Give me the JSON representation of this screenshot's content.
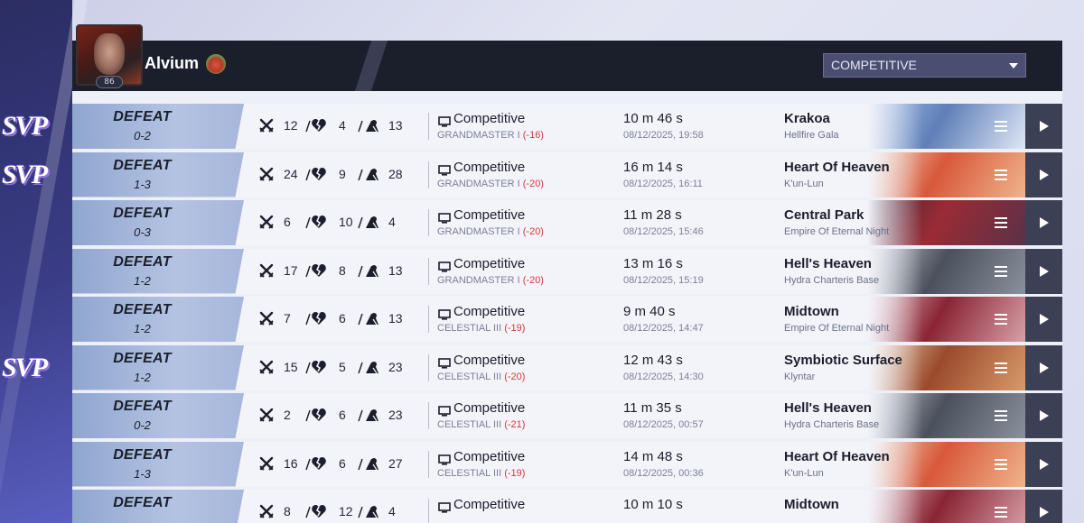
{
  "player": {
    "name": "Alvium",
    "level": "86"
  },
  "mode_select": {
    "value": "COMPETITIVE"
  },
  "svp_label": "SVP",
  "matches": [
    {
      "result": "DEFEAT",
      "score": "0-2",
      "kills": "12",
      "deaths": "4",
      "assists": "13",
      "mode": "Competitive",
      "rank": "GRANDMASTER I",
      "rank_change": "(-16)",
      "duration": "10 m 46 s",
      "datetime": "08/12/2025, 19:58",
      "map": "Krakoa",
      "map_sub": "Hellfire Gala",
      "svp": true,
      "map_colors": [
        "#a9c3e8",
        "#5f7fb8",
        "#dfe7f5"
      ]
    },
    {
      "result": "DEFEAT",
      "score": "1-3",
      "kills": "24",
      "deaths": "9",
      "assists": "28",
      "mode": "Competitive",
      "rank": "GRANDMASTER I",
      "rank_change": "(-20)",
      "duration": "16 m 14 s",
      "datetime": "08/12/2025, 16:11",
      "map": "Heart Of Heaven",
      "map_sub": "K'un-Lun",
      "svp": true,
      "map_colors": [
        "#f4d7c2",
        "#d8583a",
        "#f0b48c"
      ]
    },
    {
      "result": "DEFEAT",
      "score": "0-3",
      "kills": "6",
      "deaths": "10",
      "assists": "4",
      "mode": "Competitive",
      "rank": "GRANDMASTER I",
      "rank_change": "(-20)",
      "duration": "11 m 28 s",
      "datetime": "08/12/2025, 15:46",
      "map": "Central Park",
      "map_sub": "Empire Of Eternal Night",
      "svp": false,
      "map_colors": [
        "#3c2434",
        "#9a2b34",
        "#5b3148"
      ]
    },
    {
      "result": "DEFEAT",
      "score": "1-2",
      "kills": "17",
      "deaths": "8",
      "assists": "13",
      "mode": "Competitive",
      "rank": "GRANDMASTER I",
      "rank_change": "(-20)",
      "duration": "13 m 16 s",
      "datetime": "08/12/2025, 15:19",
      "map": "Hell's Heaven",
      "map_sub": "Hydra Charteris Base",
      "svp": false,
      "map_colors": [
        "#c8ccd4",
        "#4a505c",
        "#8a909c"
      ]
    },
    {
      "result": "DEFEAT",
      "score": "1-2",
      "kills": "7",
      "deaths": "6",
      "assists": "13",
      "mode": "Competitive",
      "rank": "CELESTIAL III",
      "rank_change": "(-19)",
      "duration": "9 m 40 s",
      "datetime": "08/12/2025, 14:47",
      "map": "Midtown",
      "map_sub": "Empire Of Eternal Night",
      "svp": false,
      "map_colors": [
        "#e6c4c8",
        "#8a2434",
        "#d8a0a8"
      ]
    },
    {
      "result": "DEFEAT",
      "score": "1-2",
      "kills": "15",
      "deaths": "5",
      "assists": "23",
      "mode": "Competitive",
      "rank": "CELESTIAL III",
      "rank_change": "(-20)",
      "duration": "12 m 43 s",
      "datetime": "08/12/2025, 14:30",
      "map": "Symbiotic Surface",
      "map_sub": "Klyntar",
      "svp": true,
      "map_colors": [
        "#f0d6b8",
        "#9a4a2c",
        "#d89a6a"
      ]
    },
    {
      "result": "DEFEAT",
      "score": "0-2",
      "kills": "2",
      "deaths": "6",
      "assists": "23",
      "mode": "Competitive",
      "rank": "CELESTIAL III",
      "rank_change": "(-21)",
      "duration": "11 m 35 s",
      "datetime": "08/12/2025, 00:57",
      "map": "Hell's Heaven",
      "map_sub": "Hydra Charteris Base",
      "svp": false,
      "map_colors": [
        "#c8ccd4",
        "#4a505c",
        "#8a909c"
      ]
    },
    {
      "result": "DEFEAT",
      "score": "1-3",
      "kills": "16",
      "deaths": "6",
      "assists": "27",
      "mode": "Competitive",
      "rank": "CELESTIAL III",
      "rank_change": "(-19)",
      "duration": "14 m 48 s",
      "datetime": "08/12/2025, 00:36",
      "map": "Heart Of Heaven",
      "map_sub": "K'un-Lun",
      "svp": false,
      "map_colors": [
        "#f4d7c2",
        "#d8583a",
        "#f0b48c"
      ]
    },
    {
      "result": "DEFEAT",
      "score": "",
      "kills": "8",
      "deaths": "12",
      "assists": "4",
      "mode": "Competitive",
      "rank": "",
      "rank_change": "",
      "duration": "10 m 10 s",
      "datetime": "",
      "map": "Midtown",
      "map_sub": "",
      "svp": false,
      "map_colors": [
        "#e6c4c8",
        "#8a2434",
        "#d8a0a8"
      ]
    }
  ]
}
